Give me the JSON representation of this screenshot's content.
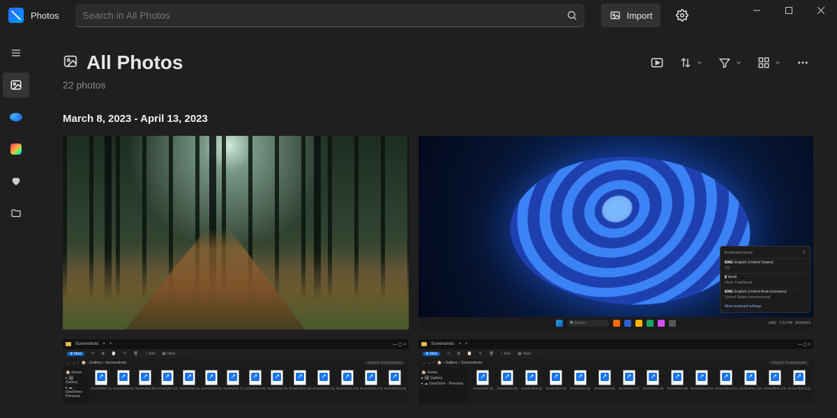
{
  "app": {
    "name": "Photos"
  },
  "search": {
    "placeholder": "Search in All Photos"
  },
  "import": {
    "label": "Import"
  },
  "win": {
    "min": "minimize",
    "max": "maximize",
    "close": "close"
  },
  "rail": {
    "items": [
      {
        "name": "menu"
      },
      {
        "name": "all-photos",
        "selected": true
      },
      {
        "name": "onedrive"
      },
      {
        "name": "icloud"
      },
      {
        "name": "favorites"
      },
      {
        "name": "folders"
      }
    ]
  },
  "page": {
    "title": "All Photos",
    "count_label": "22 photos",
    "date_range": "March 8, 2023 - April 13, 2023"
  },
  "toolbar": {
    "slideshow": "Slideshow",
    "sort": "Sort",
    "filter": "Filter",
    "layout": "Layout",
    "more": "More"
  },
  "kbpanel": {
    "header": "Keyboard layout",
    "rows": [
      {
        "tag": "ENG",
        "title": "English (United States)",
        "sub": "US"
      },
      {
        "tag": "ह",
        "title": "Hindi",
        "sub": "Hindi Traditional"
      },
      {
        "tag": "ENG",
        "title": "English (United Arab Emirates)",
        "sub": "United States-International"
      }
    ],
    "footer": "More keyboard settings"
  },
  "taskbar": {
    "search": "Search",
    "time": "7:21 PM",
    "date": "3/24/2023"
  },
  "explorer": {
    "tab": "Screenshots",
    "new": "New",
    "sort": "Sort",
    "view": "View",
    "more": "···",
    "crumb_home": "Gallery",
    "crumb_loc": "Screenshots",
    "search_ph": "Search Screenshots",
    "side": [
      "Home",
      "Gallery",
      "OneDrive - Persona"
    ],
    "files": [
      "Screenshot (1)",
      "Screenshot (2)",
      "Screenshot (3)",
      "Screenshot (4)",
      "Screenshot (5)",
      "Screenshot (6)",
      "Screenshot (7)",
      "Screenshot (8)",
      "Screenshot (9)",
      "Screenshot (10)",
      "Screenshot (11)",
      "Screenshot (12)",
      "Screenshot (13)",
      "Screenshot (14)"
    ]
  }
}
